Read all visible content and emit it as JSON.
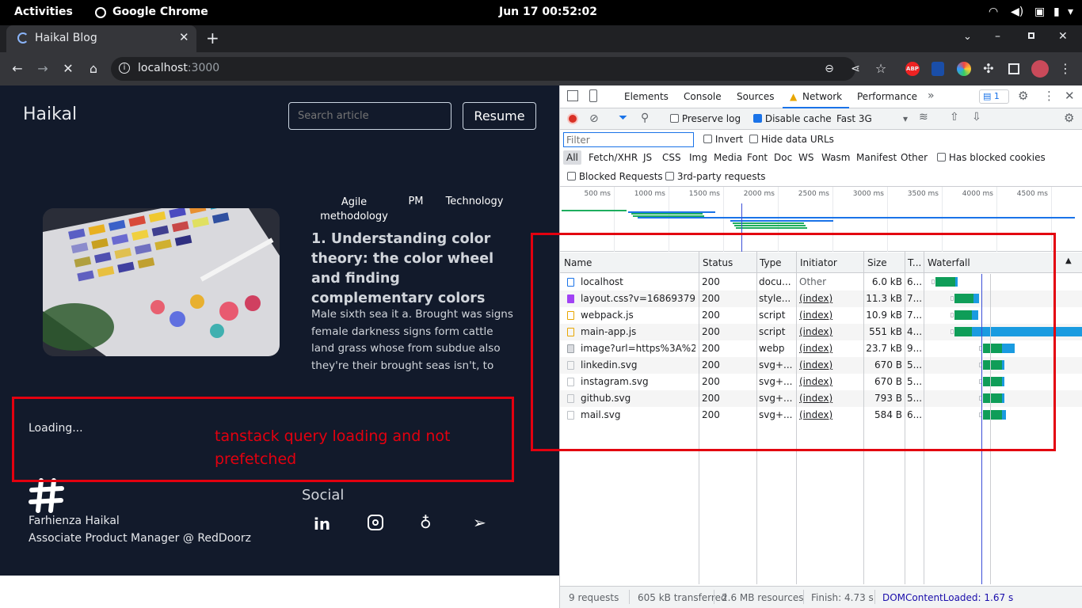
{
  "system": {
    "activities": "Activities",
    "app": "Google Chrome",
    "clock": "Jun 17  00:52:02"
  },
  "browser": {
    "tab_title": "Haikal Blog",
    "url_host": "localhost",
    "url_port": ":3000"
  },
  "site": {
    "brand": "Haikal",
    "search_placeholder": "Search article",
    "resume": "Resume",
    "tags": [
      "Agile methodology",
      "PM",
      "Technology"
    ],
    "article_title": "1. Understanding color theory: the color wheel and finding complementary colors",
    "article_excerpt": "Male sixth sea it a. Brought was signs female darkness signs form cattle land grass whose from subdue also they're their brought seas isn't, to",
    "loading": "Loading...",
    "annotation": "tanstack query loading and not prefetched",
    "footer_name": "Farhienza Haikal",
    "footer_role": "Associate Product Manager @ RedDoorz",
    "social_title": "Social"
  },
  "devtools": {
    "tabs": [
      "Elements",
      "Console",
      "Sources",
      "Network",
      "Performance"
    ],
    "issues_count": "1",
    "preserve_log": "Preserve log",
    "disable_cache": "Disable cache",
    "throttle": "Fast 3G",
    "filter_placeholder": "Filter",
    "invert": "Invert",
    "hide_data_urls": "Hide data URLs",
    "type_filters": [
      "All",
      "Fetch/XHR",
      "JS",
      "CSS",
      "Img",
      "Media",
      "Font",
      "Doc",
      "WS",
      "Wasm",
      "Manifest",
      "Other"
    ],
    "has_blocked_cookies": "Has blocked cookies",
    "blocked_requests": "Blocked Requests",
    "third_party": "3rd-party requests",
    "timeline_ticks": [
      "500 ms",
      "1000 ms",
      "1500 ms",
      "2000 ms",
      "2500 ms",
      "3000 ms",
      "3500 ms",
      "4000 ms",
      "4500 ms",
      "50"
    ],
    "columns": [
      "Name",
      "Status",
      "Type",
      "Initiator",
      "Size",
      "T...",
      "Waterfall"
    ],
    "rows": [
      {
        "name": "localhost",
        "status": "200",
        "type": "docu...",
        "initiator": "Other",
        "size": "6.0 kB",
        "time": "6..."
      },
      {
        "name": "layout.css?v=16869379...",
        "status": "200",
        "type": "style...",
        "initiator": "(index)",
        "size": "11.3 kB",
        "time": "7..."
      },
      {
        "name": "webpack.js",
        "status": "200",
        "type": "script",
        "initiator": "(index)",
        "size": "10.9 kB",
        "time": "7..."
      },
      {
        "name": "main-app.js",
        "status": "200",
        "type": "script",
        "initiator": "(index)",
        "size": "551 kB",
        "time": "4..."
      },
      {
        "name": "image?url=https%3A%2...",
        "status": "200",
        "type": "webp",
        "initiator": "(index)",
        "size": "23.7 kB",
        "time": "9..."
      },
      {
        "name": "linkedin.svg",
        "status": "200",
        "type": "svg+...",
        "initiator": "(index)",
        "size": "670 B",
        "time": "5..."
      },
      {
        "name": "instagram.svg",
        "status": "200",
        "type": "svg+...",
        "initiator": "(index)",
        "size": "670 B",
        "time": "5..."
      },
      {
        "name": "github.svg",
        "status": "200",
        "type": "svg+...",
        "initiator": "(index)",
        "size": "793 B",
        "time": "5..."
      },
      {
        "name": "mail.svg",
        "status": "200",
        "type": "svg+...",
        "initiator": "(index)",
        "size": "584 B",
        "time": "6..."
      }
    ],
    "status_bar": {
      "requests": "9 requests",
      "transferred": "605 kB transferred",
      "resources": "2.6 MB resources",
      "finish": "Finish: 4.73 s",
      "dcl": "DOMContentLoaded: 1.67 s"
    }
  }
}
